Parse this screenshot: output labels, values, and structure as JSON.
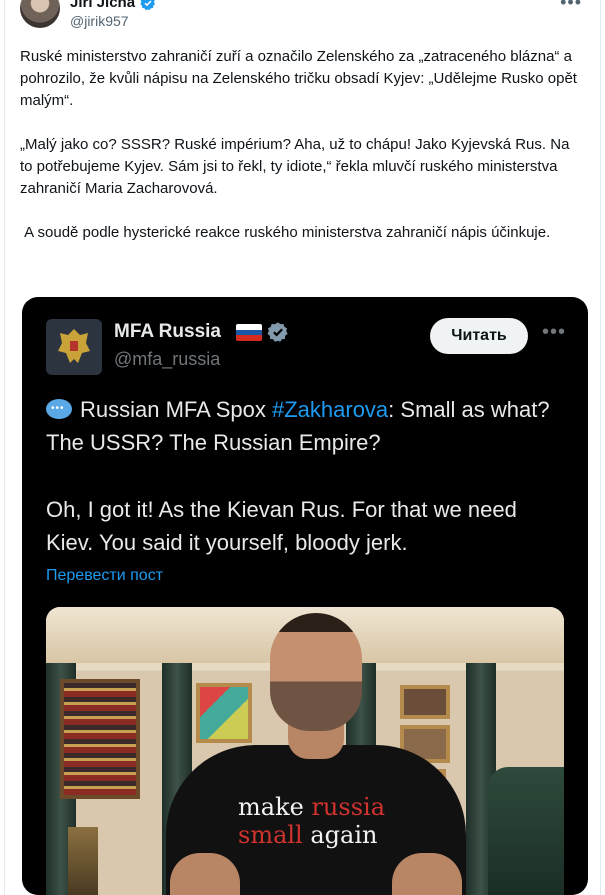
{
  "author": {
    "name": "Jiří Jícha",
    "handle": "@jirik957",
    "verified": true
  },
  "tweet": {
    "paragraphs": [
      "Ruské ministerstvo zahraničí zuří a označilo Zelenského za „zatraceného blázna“ a pohrozilo, že kvůli nápisu na Zelenského tričku obsadí Kyjev: „Udělejme Rusko opět malým“.",
      "„Malý jako co? SSSR? Ruské impérium? Aha, už to chápu! Jako Kyjevská Rus. Na to potřebujeme Kyjev. Sám jsi to řekl, ty idiote,“ řekla mluvčí ruského ministerstva zahraničí Maria Zacharovová.",
      " A soudě podle hysterické reakce ruského ministerstva zahraničí nápis účinkuje."
    ]
  },
  "embed": {
    "name": "MFA Russia",
    "handle": "@mfa_russia",
    "read_button": "Читать",
    "text_line1_prefix": "Russian MFA Spox ",
    "hashtag": "#Zakharova",
    "text_line1_suffix": ": Small as what? The USSR? The Russian Empire?",
    "text_para2": "Oh, I got it! As the Kievan Rus. For that we need Kiev. You said it yourself, bloody jerk.",
    "translate_link": "Перевести пост",
    "shirt_line1_a": "make ",
    "shirt_line1_b": "russia",
    "shirt_line2_a": "small",
    "shirt_line2_b": " again"
  },
  "colors": {
    "accent": "#1d9bf0",
    "embed_bg": "#000000",
    "shirt_red": "#d1332f"
  },
  "icons": [
    "verified-badge-icon",
    "more-options-icon",
    "speech-bubble-icon",
    "russian-flag-icon",
    "coat-of-arms-icon"
  ]
}
